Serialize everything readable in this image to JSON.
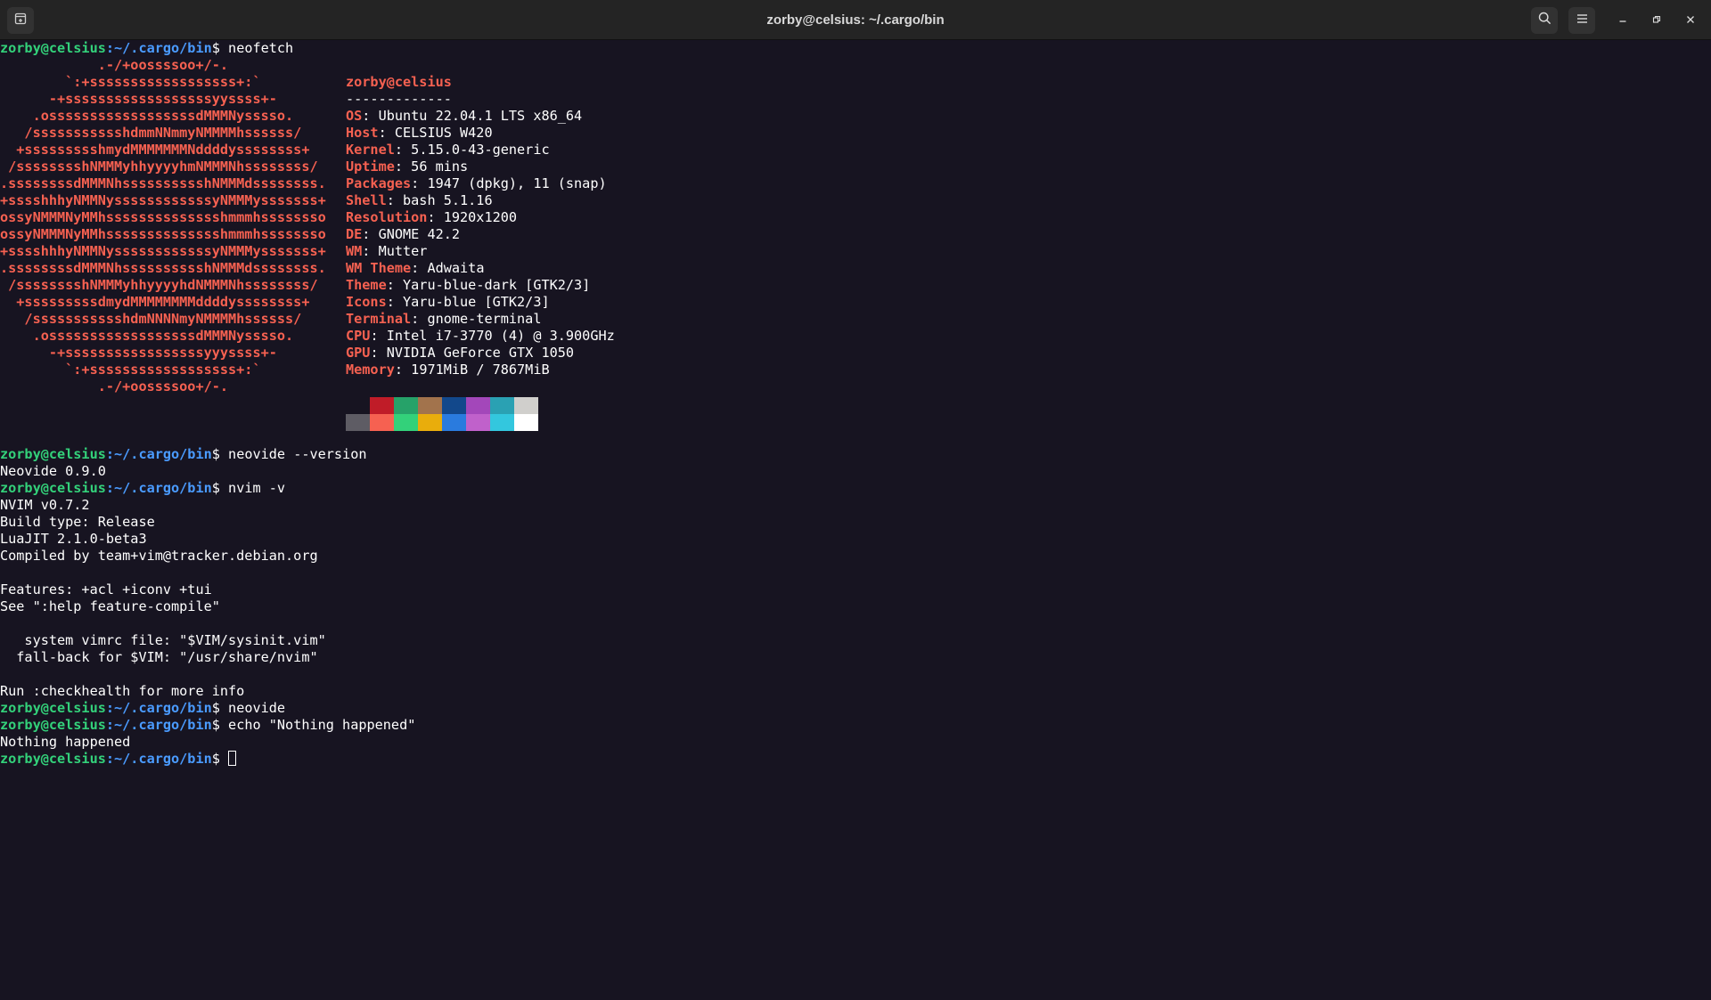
{
  "window": {
    "title": "zorby@celsius: ~/.cargo/bin"
  },
  "titlebar_icons": {
    "new_tab": "new-tab-icon",
    "search": "search-icon",
    "menu": "hamburger-menu-icon",
    "minimize": "minimize-icon",
    "restore": "restore-icon",
    "close": "close-icon"
  },
  "prompt": {
    "user_host": "zorby@celsius",
    "path": ":~/.cargo/bin",
    "symbol": "$ "
  },
  "commands": {
    "neofetch": "neofetch",
    "neovide_version": "neovide --version",
    "nvim_v": "nvim -v",
    "neovide": "neovide",
    "echo": "echo \"Nothing happened\""
  },
  "ascii_art": [
    "            .-/+oossssoo+/-.",
    "        `:+ssssssssssssssssss+:`",
    "      -+ssssssssssssssssssyyssss+-",
    "    .ossssssssssssssssssdMMMNysssso.",
    "   /ssssssssssshdmmNNmmyNMMMMhssssss/",
    "  +ssssssssshmydMMMMMMMNddddyssssssss+",
    " /sssssssshNMMMyhhyyyyhmNMMMNhssssssss/",
    ".ssssssssdMMMNhsssssssssshNMMMdssssssss.",
    "+sssshhhyNMMNyssssssssssssyNMMMysssssss+",
    "ossyNMMMNyMMhsssssssssssssshmmmhssssssso",
    "ossyNMMMNyMMhsssssssssssssshmmmhssssssso",
    "+sssshhhyNMMNyssssssssssssyNMMMysssssss+",
    ".ssssssssdMMMNhsssssssssshNMMMdssssssss.",
    " /sssssssshNMMMyhhyyyyhdNMMMNhssssssss/",
    "  +sssssssssdmydMMMMMMMMddddyssssssss+",
    "   /ssssssssssshdmNNNNmyNMMMMhssssss/",
    "    .ossssssssssssssssssdMMMNysssso.",
    "      -+sssssssssssssssssyyyssss+-",
    "        `:+ssssssssssssssssss+:`",
    "            .-/+oossssoo+/-."
  ],
  "neofetch": {
    "user": "zorby",
    "host": "celsius",
    "separator": "-------------",
    "fields": [
      {
        "key": "OS",
        "value": "Ubuntu 22.04.1 LTS x86_64"
      },
      {
        "key": "Host",
        "value": "CELSIUS W420"
      },
      {
        "key": "Kernel",
        "value": "5.15.0-43-generic"
      },
      {
        "key": "Uptime",
        "value": "56 mins"
      },
      {
        "key": "Packages",
        "value": "1947 (dpkg), 11 (snap)"
      },
      {
        "key": "Shell",
        "value": "bash 5.1.16"
      },
      {
        "key": "Resolution",
        "value": "1920x1200"
      },
      {
        "key": "DE",
        "value": "GNOME 42.2"
      },
      {
        "key": "WM",
        "value": "Mutter"
      },
      {
        "key": "WM Theme",
        "value": "Adwaita"
      },
      {
        "key": "Theme",
        "value": "Yaru-blue-dark [GTK2/3]"
      },
      {
        "key": "Icons",
        "value": "Yaru-blue [GTK2/3]"
      },
      {
        "key": "Terminal",
        "value": "gnome-terminal"
      },
      {
        "key": "CPU",
        "value": "Intel i7-3770 (4) @ 3.900GHz"
      },
      {
        "key": "GPU",
        "value": "NVIDIA GeForce GTX 1050"
      },
      {
        "key": "Memory",
        "value": "1971MiB / 7867MiB"
      }
    ],
    "palette_dark": [
      "#171421",
      "#c01c28",
      "#26a269",
      "#a2734c",
      "#12488b",
      "#a347ba",
      "#2aa1b3",
      "#d0cfcc"
    ],
    "palette_bright": [
      "#5e5c64",
      "#f66151",
      "#33d17a",
      "#e9ad0c",
      "#2a7bde",
      "#c061cb",
      "#33c7de",
      "#ffffff"
    ]
  },
  "outputs": {
    "neovide_version": [
      "Neovide 0.9.0"
    ],
    "nvim": [
      "NVIM v0.7.2",
      "Build type: Release",
      "LuaJIT 2.1.0-beta3",
      "Compiled by team+vim@tracker.debian.org",
      "",
      "Features: +acl +iconv +tui",
      "See \":help feature-compile\"",
      "",
      "   system vimrc file: \"$VIM/sysinit.vim\"",
      "  fall-back for $VIM: \"/usr/share/nvim\"",
      "",
      "Run :checkhealth for more info"
    ],
    "echo": [
      "Nothing happened"
    ]
  }
}
